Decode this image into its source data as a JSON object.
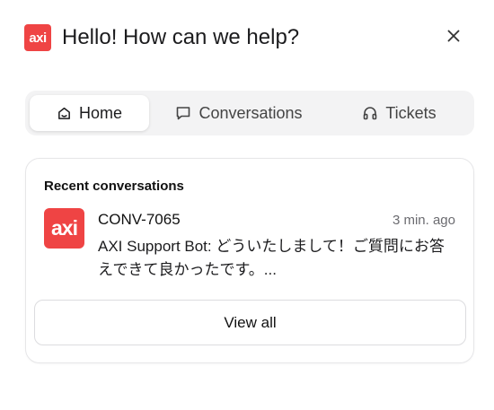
{
  "header": {
    "logo_text": "axi",
    "title": "Hello! How can we help?",
    "close_icon": "close-icon"
  },
  "tabs": [
    {
      "label": "Home",
      "icon": "home-icon",
      "active": true
    },
    {
      "label": "Conversations",
      "icon": "chat-bubble-icon",
      "active": false
    },
    {
      "label": "Tickets",
      "icon": "headphones-icon",
      "active": false
    }
  ],
  "recent": {
    "title": "Recent conversations",
    "items": [
      {
        "avatar_text": "axi",
        "id": "CONV-7065",
        "time": "3 min. ago",
        "message": "AXI Support Bot: どういたしまして！ご質問にお答えできて良かったです。..."
      }
    ],
    "view_all_label": "View all"
  },
  "colors": {
    "brand": "#ef4444",
    "tabs_bg": "#f3f3f4",
    "muted_text": "#6b6b70"
  }
}
